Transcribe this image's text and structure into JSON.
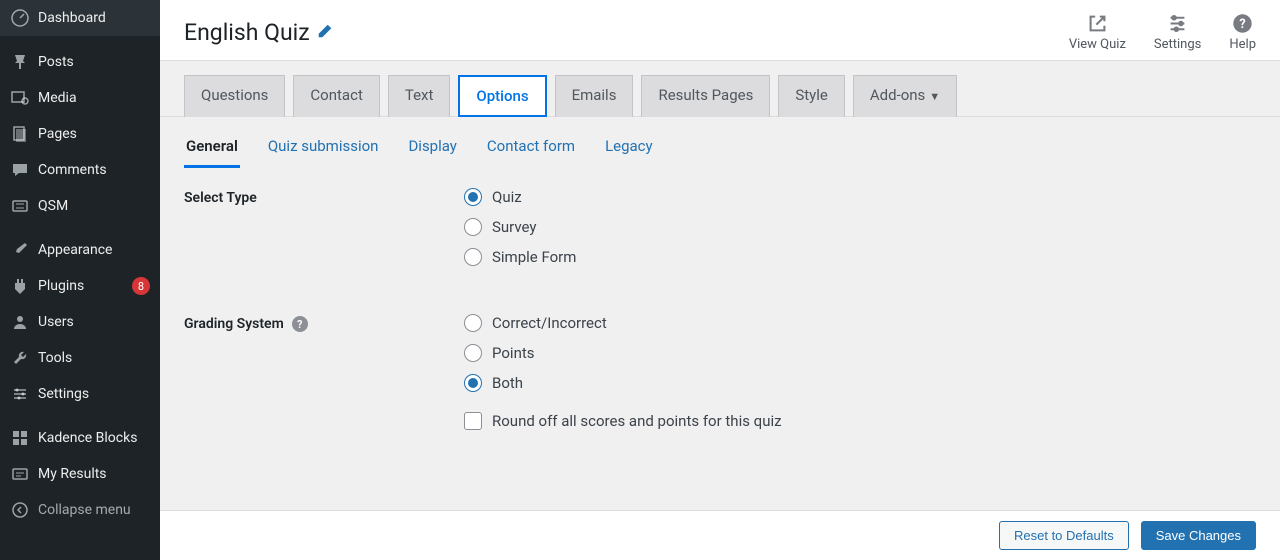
{
  "sidebar": {
    "items": [
      {
        "label": "Dashboard"
      },
      {
        "label": "Posts"
      },
      {
        "label": "Media"
      },
      {
        "label": "Pages"
      },
      {
        "label": "Comments"
      },
      {
        "label": "QSM"
      },
      {
        "label": "Appearance"
      },
      {
        "label": "Plugins",
        "badge": "8"
      },
      {
        "label": "Users"
      },
      {
        "label": "Tools"
      },
      {
        "label": "Settings"
      },
      {
        "label": "Kadence Blocks"
      },
      {
        "label": "My Results"
      },
      {
        "label": "Collapse menu"
      }
    ]
  },
  "header": {
    "title": "English Quiz",
    "actions": {
      "view_quiz": "View Quiz",
      "settings": "Settings",
      "help": "Help"
    }
  },
  "tabs": {
    "questions": "Questions",
    "contact": "Contact",
    "text": "Text",
    "options": "Options",
    "emails": "Emails",
    "results_pages": "Results Pages",
    "style": "Style",
    "addons": "Add-ons"
  },
  "subtabs": {
    "general": "General",
    "quiz_submission": "Quiz submission",
    "display": "Display",
    "contact_form": "Contact form",
    "legacy": "Legacy"
  },
  "fields": {
    "select_type": {
      "label": "Select Type",
      "options": {
        "quiz": "Quiz",
        "survey": "Survey",
        "simple_form": "Simple Form"
      }
    },
    "grading_system": {
      "label": "Grading System",
      "options": {
        "correct_incorrect": "Correct/Incorrect",
        "points": "Points",
        "both": "Both"
      },
      "round_off": "Round off all scores and points for this quiz"
    }
  },
  "footer": {
    "reset": "Reset to Defaults",
    "save": "Save Changes"
  }
}
